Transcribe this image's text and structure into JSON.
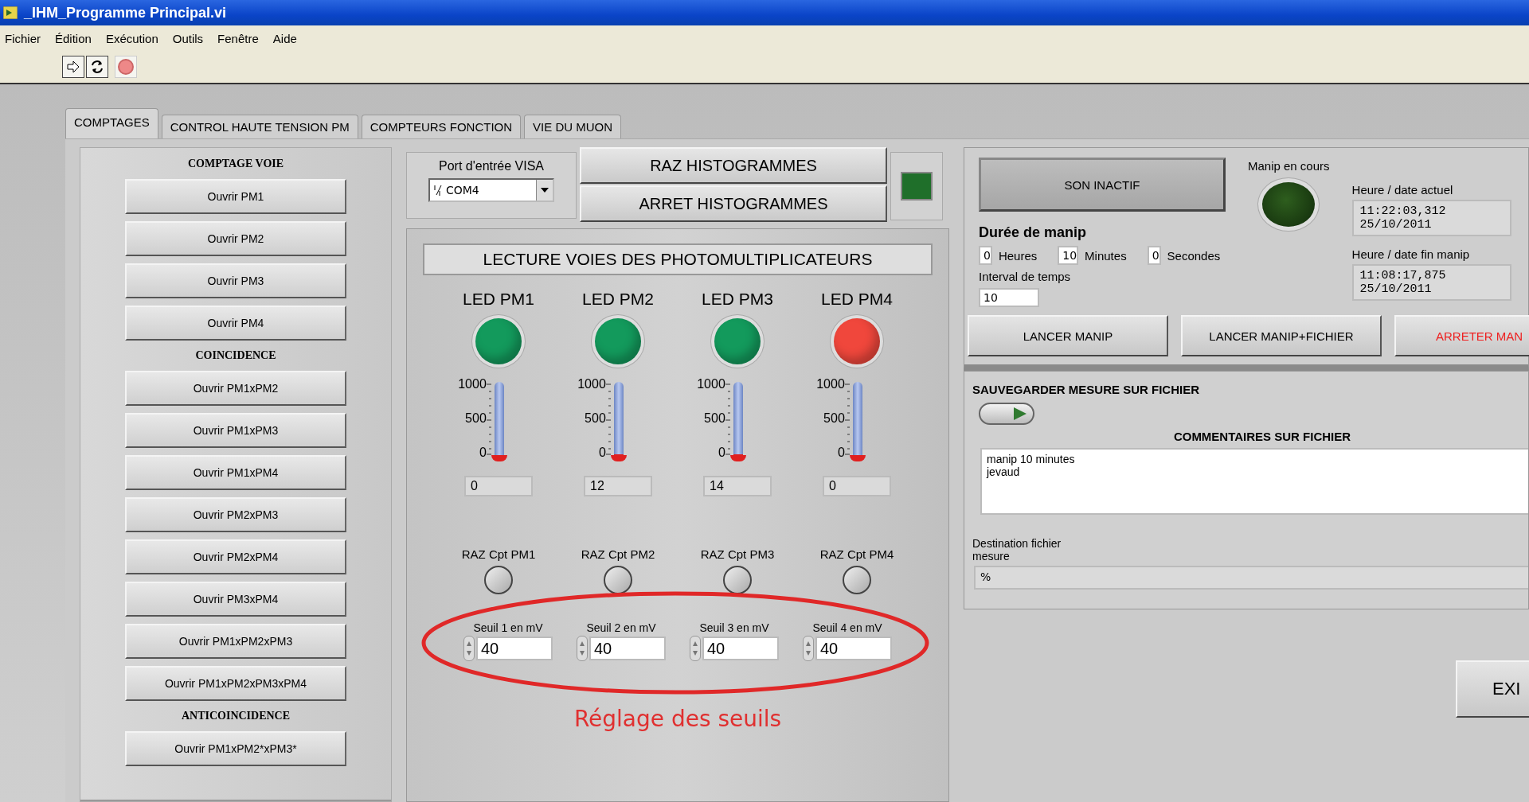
{
  "window": {
    "title": "_IHM_Programme Principal.vi"
  },
  "menu": [
    "Fichier",
    "Édition",
    "Exécution",
    "Outils",
    "Fenêtre",
    "Aide"
  ],
  "tabs": [
    {
      "label": "COMPTAGES",
      "selected": true
    },
    {
      "label": "CONTROL HAUTE TENSION PM",
      "selected": false
    },
    {
      "label": "COMPTEURS FONCTION",
      "selected": false
    },
    {
      "label": "VIE DU MUON",
      "selected": false
    }
  ],
  "counting_panel": {
    "sections": [
      {
        "heading": "COMPTAGE VOIE",
        "buttons": [
          "Ouvrir PM1",
          "Ouvrir PM2",
          "Ouvrir PM3",
          "Ouvrir PM4"
        ]
      },
      {
        "heading": "COINCIDENCE",
        "buttons": [
          "Ouvrir PM1xPM2",
          "Ouvrir PM1xPM3",
          "Ouvrir PM1xPM4",
          "Ouvrir PM2xPM3",
          "Ouvrir PM2xPM4",
          "Ouvrir PM3xPM4",
          "Ouvrir PM1xPM2xPM3",
          "Ouvrir PM1xPM2xPM3xPM4"
        ]
      },
      {
        "heading": "ANTICOINCIDENCE",
        "buttons": [
          "Ouvrir PM1xPM2*xPM3*"
        ]
      }
    ]
  },
  "visa": {
    "label": "Port d'entrée VISA",
    "value": "COM4"
  },
  "histogram_buttons": [
    "RAZ HISTOGRAMMES",
    "ARRET HISTOGRAMMES"
  ],
  "histogram_indicator": {
    "on": true
  },
  "readout": {
    "title": "LECTURE VOIES DES PHOTOMULTIPLICATEURS",
    "channels": [
      {
        "led_label": "LED PM1",
        "color": "#139a5c",
        "scale": [
          "1000",
          "500",
          "0"
        ],
        "level": 0,
        "value": "0",
        "reset_label": "RAZ Cpt PM1",
        "threshold_label": "Seuil 1 en mV",
        "threshold": "40"
      },
      {
        "led_label": "LED PM2",
        "color": "#139a5c",
        "scale": [
          "1000",
          "500",
          "0"
        ],
        "level": 0.012,
        "value": "12",
        "reset_label": "RAZ Cpt PM2",
        "threshold_label": "Seuil 2 en mV",
        "threshold": "40"
      },
      {
        "led_label": "LED PM3",
        "color": "#139a5c",
        "scale": [
          "1000",
          "500",
          "0"
        ],
        "level": 0.014,
        "value": "14",
        "reset_label": "RAZ Cpt PM3",
        "threshold_label": "Seuil 3 en mV",
        "threshold": "40"
      },
      {
        "led_label": "LED PM4",
        "color": "#f0473c",
        "scale": [
          "1000",
          "500",
          "0"
        ],
        "level": 0,
        "value": "0",
        "reset_label": "RAZ Cpt PM4",
        "threshold_label": "Seuil 4 en mV",
        "threshold": "40"
      }
    ]
  },
  "annotation": "Réglage des seuils",
  "run_panel": {
    "sound_button": "SON INACTIF",
    "running": {
      "label": "Manip en cours",
      "on": false
    },
    "duration": {
      "title": "Durée de manip",
      "fields": [
        {
          "value": "0",
          "unit": "Heures"
        },
        {
          "value": "10",
          "unit": "Minutes"
        },
        {
          "value": "0",
          "unit": "Secondes"
        }
      ]
    },
    "interval": {
      "label": "Interval de temps",
      "value": "10"
    },
    "current_time": {
      "label": "Heure / date actuel",
      "lines": [
        "11:22:03,312",
        "25/10/2011"
      ]
    },
    "end_time": {
      "label": "Heure / date fin manip",
      "lines": [
        "11:08:17,875",
        "25/10/2011"
      ]
    },
    "buttons": [
      {
        "label": "LANCER MANIP",
        "kind": "normal"
      },
      {
        "label": "LANCER MANIP+FICHIER",
        "kind": "normal"
      },
      {
        "label": "ARRETER MAN",
        "kind": "stop"
      }
    ]
  },
  "save_panel": {
    "title": "SAUVEGARDER MESURE SUR FICHIER",
    "toggle_on": true,
    "comments_title": "COMMENTAIRES SUR FICHIER",
    "comments": "manip 10 minutes\njevaud",
    "destination_label": "Destination fichier mesure",
    "destination_value": "%"
  },
  "exit_button": "EXI"
}
